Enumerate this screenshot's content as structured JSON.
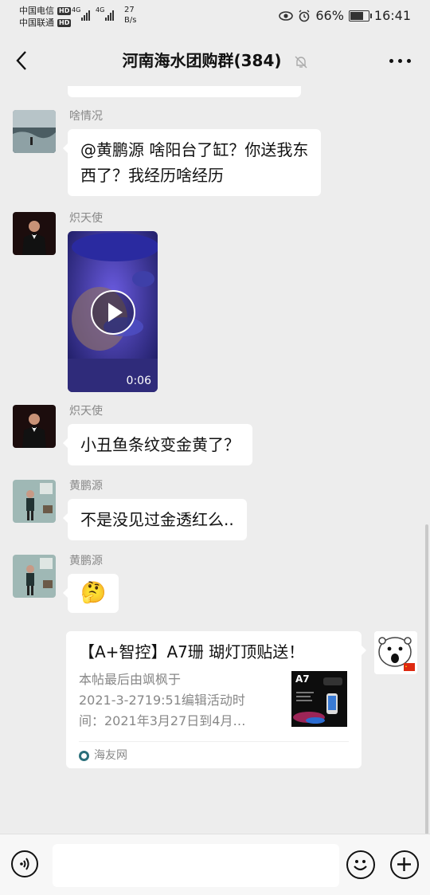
{
  "status_bar": {
    "carrier1": "中国电信",
    "carrier2": "中国联通",
    "hd": "HD",
    "net1": "4G",
    "net2": "4G",
    "speed_value": "27",
    "speed_unit": "B/s",
    "battery": "66%",
    "battery_level": 0.66,
    "time": "16:41"
  },
  "header": {
    "title": "河南海水团购群(384)"
  },
  "messages": [
    {
      "sender": "啥情况",
      "lines": [
        "@黄鹏源  啥阳台了缸？你送我东",
        "西了？我经历啥经历"
      ]
    },
    {
      "sender": "炽天使",
      "video_duration": "0:06"
    },
    {
      "sender": "炽天使",
      "text": "小丑鱼条纹变金黄了？"
    },
    {
      "sender": "黄鹏源",
      "text": "不是没见过金透红么.."
    },
    {
      "sender": "黄鹏源",
      "emoji": "🤔"
    }
  ],
  "link_card": {
    "title": "【A+智控】A7珊 瑚灯顶贴送！",
    "desc_lines": [
      "本帖最后由飒枫于",
      "2021-3-2719:51编辑活动时",
      "间：2021年3月27日到4月…"
    ],
    "thumb_label": "A7",
    "source": "海友网"
  },
  "colors": {
    "background": "#ededed",
    "bubble": "#ffffff",
    "meta_text": "#888888"
  },
  "icons": [
    "back-arrow-icon",
    "mute-bell-icon",
    "more-icon",
    "play-icon",
    "voice-icon",
    "emoji-icon",
    "plus-icon"
  ]
}
